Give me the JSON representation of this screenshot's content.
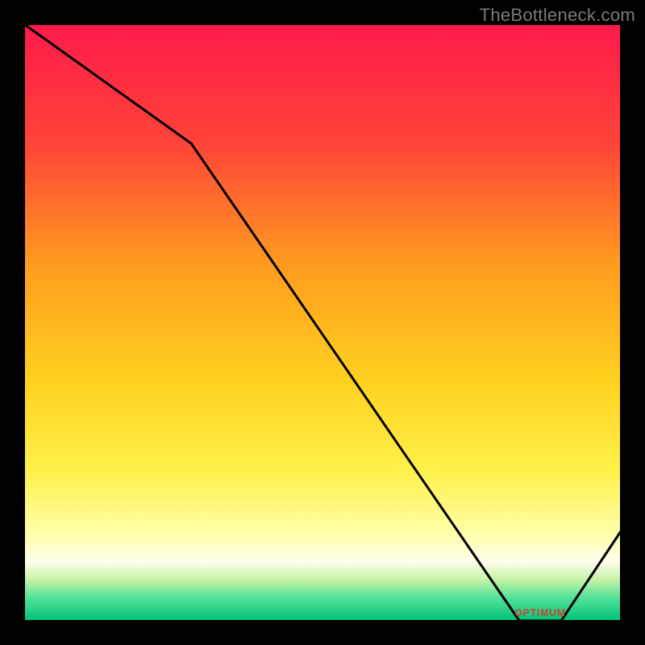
{
  "attribution": "TheBottleneck.com",
  "chart_data": {
    "type": "line",
    "title": "",
    "xlabel": "",
    "ylabel": "",
    "xlim": [
      0,
      100
    ],
    "ylim": [
      0,
      100
    ],
    "x": [
      0,
      28,
      83,
      90,
      100
    ],
    "values": [
      100,
      80,
      0,
      0,
      15
    ],
    "optimum_band": {
      "x_start": 83,
      "x_end": 90,
      "label": "OPTIMUM"
    },
    "background_gradient": {
      "stops": [
        {
          "pos": 0.0,
          "color": "#ff1a4b"
        },
        {
          "pos": 0.2,
          "color": "#ff4438"
        },
        {
          "pos": 0.4,
          "color": "#ff9a1f"
        },
        {
          "pos": 0.6,
          "color": "#ffd21f"
        },
        {
          "pos": 0.75,
          "color": "#fff14a"
        },
        {
          "pos": 0.86,
          "color": "#ffffb0"
        },
        {
          "pos": 0.9,
          "color": "#ffffef"
        },
        {
          "pos": 0.93,
          "color": "#c9f3a8"
        },
        {
          "pos": 0.96,
          "color": "#57e39a"
        },
        {
          "pos": 1.0,
          "color": "#00c27a"
        }
      ]
    },
    "optimum_label_color": "#d23b2a"
  }
}
